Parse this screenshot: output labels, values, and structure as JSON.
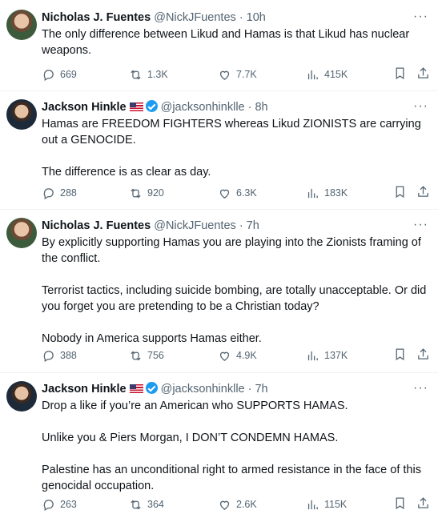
{
  "tweets": [
    {
      "name": "Nicholas J. Fuentes",
      "handle": "@NickJFuentes",
      "time": "· 10h",
      "paragraphs": [
        "The only difference between Likud and Hamas is that Likud has nuclear weapons."
      ],
      "replies": "669",
      "retweets": "1.3K",
      "likes": "7.7K",
      "views": "415K"
    },
    {
      "name": "Jackson Hinkle",
      "handle": "@jacksonhinklle",
      "time": "· 8h",
      "paragraphs": [
        "Hamas are FREEDOM FIGHTERS whereas Likud ZIONISTS are carrying out a GENOCIDE.",
        "The difference is as clear as day."
      ],
      "replies": "288",
      "retweets": "920",
      "likes": "6.3K",
      "views": "183K"
    },
    {
      "name": "Nicholas J. Fuentes",
      "handle": "@NickJFuentes",
      "time": "· 7h",
      "paragraphs": [
        "By explicitly supporting Hamas you are playing into the Zionists framing of the conflict.",
        "Terrorist tactics, including suicide bombing, are totally unacceptable. Or did you forget you are pretending to be a Christian today?",
        "Nobody in America supports Hamas either."
      ],
      "replies": "388",
      "retweets": "756",
      "likes": "4.9K",
      "views": "137K"
    },
    {
      "name": "Jackson Hinkle",
      "handle": "@jacksonhinklle",
      "time": "· 7h",
      "paragraphs": [
        "Drop a like if you’re an American who SUPPORTS HAMAS.",
        "Unlike you & Piers Morgan, I DON’T CONDEMN HAMAS.",
        "Palestine has an unconditional right to armed resistance in the face of this genocidal occupation."
      ],
      "replies": "263",
      "retweets": "364",
      "likes": "2.6K",
      "views": "115K"
    }
  ]
}
